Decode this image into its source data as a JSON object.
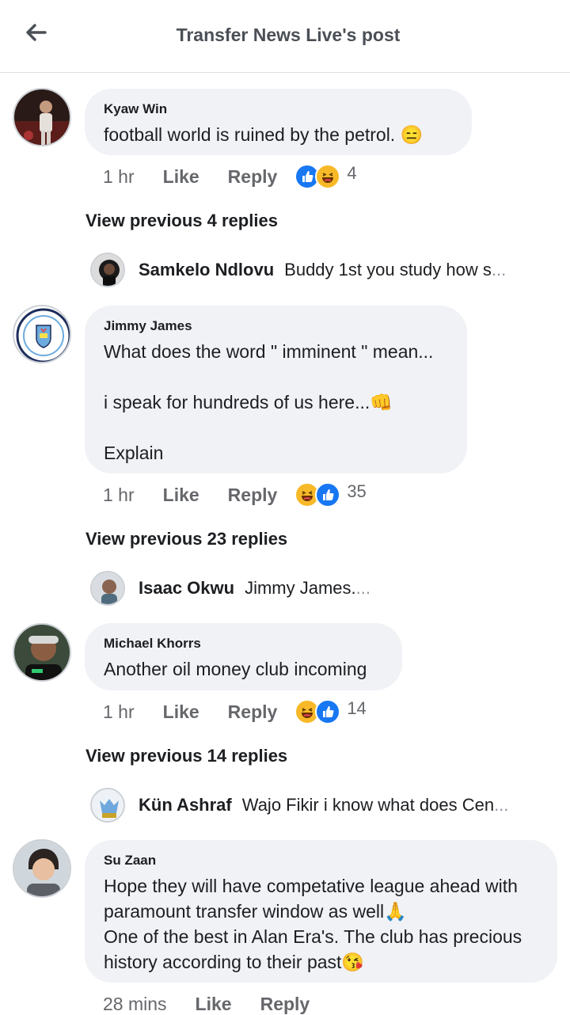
{
  "header": {
    "title": "Transfer News Live's post",
    "back_icon": "arrow-left-icon"
  },
  "comments": [
    {
      "author": "Kyaw Win",
      "text": "football  world  is ruined by the petrol. 😑",
      "time": "1 hr",
      "like": "Like",
      "reply": "Reply",
      "reaction_count": "4",
      "view_previous": "View previous 4 replies",
      "latest_reply": {
        "name": "Samkelo Ndlovu",
        "text": "Buddy 1st you study how s",
        "ellipsis": "..."
      }
    },
    {
      "author": "Jimmy James",
      "text": "What does the word \" imminent \" mean...\n\ni speak for hundreds of us here...👊\n\nExplain",
      "time": "1 hr",
      "like": "Like",
      "reply": "Reply",
      "reaction_count": "35",
      "view_previous": "View previous 23 replies",
      "latest_reply": {
        "name": "Isaac Okwu",
        "text": "Jimmy James.",
        "ellipsis": "..."
      }
    },
    {
      "author": "Michael Khorrs",
      "text": "Another oil money club incoming",
      "time": "1 hr",
      "like": "Like",
      "reply": "Reply",
      "reaction_count": "14",
      "view_previous": "View previous 14 replies",
      "latest_reply": {
        "name": "Kün Ashraf",
        "text": "Wajo Fikir  i know what does Cen",
        "ellipsis": "..."
      }
    },
    {
      "author": "Su Zaan",
      "text": "Hope they will have competative league ahead with paramount transfer window as well🙏\nOne of the best in Alan Era's. The club has precious history  according to their past😘",
      "time": "28 mins",
      "like": "Like",
      "reply": "Reply"
    }
  ],
  "colors": {
    "like_blue": "#1877f2",
    "haha_yellow": "#f7b928",
    "bubble_bg": "#f0f2f5",
    "meta_gray": "#65676b"
  }
}
